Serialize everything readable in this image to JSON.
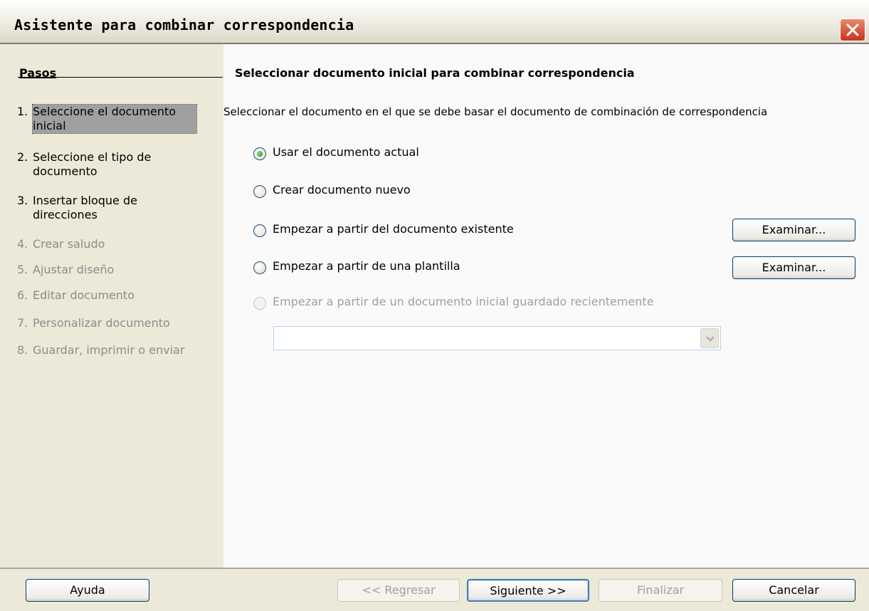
{
  "window": {
    "title": "Asistente para combinar correspondencia",
    "close_icon": "close-icon"
  },
  "steps_panel": {
    "heading": "Pasos",
    "steps": [
      {
        "num": "1.",
        "label": "Seleccione el documento inicial",
        "state": "active"
      },
      {
        "num": "2.",
        "label": "Seleccione el tipo de documento",
        "state": "enabled"
      },
      {
        "num": "3.",
        "label": "Insertar bloque de direcciones",
        "state": "enabled"
      },
      {
        "num": "4.",
        "label": "Crear saludo",
        "state": "disabled"
      },
      {
        "num": "5.",
        "label": "Ajustar diseño",
        "state": "disabled"
      },
      {
        "num": "6.",
        "label": "Editar documento",
        "state": "disabled"
      },
      {
        "num": "7.",
        "label": "Personalizar documento",
        "state": "disabled"
      },
      {
        "num": "8.",
        "label": "Guardar, imprimir o enviar",
        "state": "disabled"
      }
    ]
  },
  "main": {
    "heading": "Seleccionar documento inicial para combinar correspondencia",
    "description": "Seleccionar el documento en el que se debe basar el documento de combinación de correspondencia",
    "options": [
      {
        "label": "Usar el documento actual",
        "checked": true
      },
      {
        "label": "Crear documento nuevo",
        "checked": false
      },
      {
        "label": "Empezar a partir del documento existente",
        "checked": false
      },
      {
        "label": "Empezar a partir de una plantilla",
        "checked": false
      },
      {
        "label": "Empezar a partir de un documento inicial guardado recientemente",
        "checked": false,
        "disabled": true
      }
    ],
    "browse_label": "Examinar...",
    "recent_select_value": ""
  },
  "footer": {
    "help": "Ayuda",
    "back": "<< Regresar",
    "next": "Siguiente >>",
    "finish": "Finalizar",
    "cancel": "Cancelar"
  }
}
